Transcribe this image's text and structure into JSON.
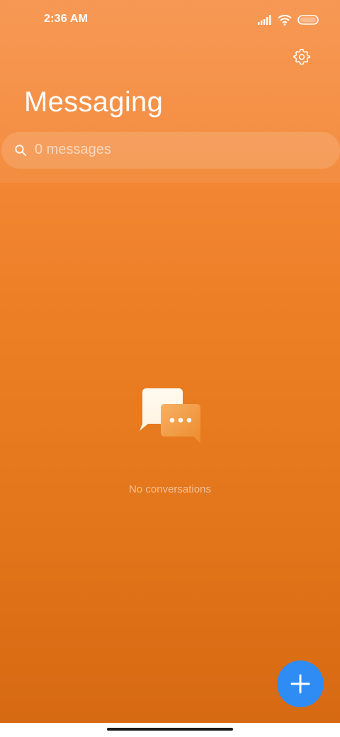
{
  "status_bar": {
    "time": "2:36 AM",
    "icons": [
      "signal-icon",
      "wifi-icon",
      "battery-icon"
    ]
  },
  "header": {
    "title": "Messaging",
    "settings_icon": "gear-icon"
  },
  "search": {
    "placeholder": "0 messages",
    "icon": "search-icon"
  },
  "empty_state": {
    "icon": "chat-bubbles-icon",
    "message": "No conversations"
  },
  "fab": {
    "icon": "plus-icon",
    "color": "#2f8cf5"
  },
  "colors": {
    "background_top": "#f69046",
    "background_bottom": "#d66a12",
    "accent": "#2f8cf5"
  }
}
